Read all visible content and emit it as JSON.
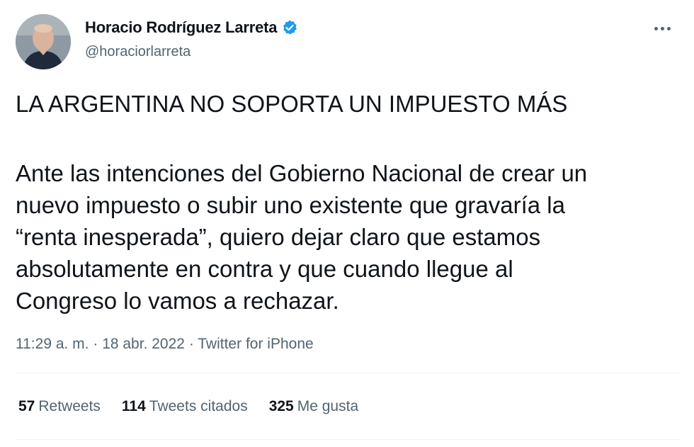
{
  "author": {
    "name": "Horacio Rodríguez Larreta",
    "handle": "@horaciorlarreta",
    "verified_icon": "verified-badge-icon"
  },
  "more_icon": "more-options-icon",
  "tweet": {
    "headline": "LA ARGENTINA NO SOPORTA UN IMPUESTO MÁS",
    "body_lines": [
      "Ante las intenciones del Gobierno Nacional de crear un",
      "nuevo impuesto o subir uno existente que gravaría la",
      "“renta inesperada”, quiero dejar claro que estamos",
      "absolutamente en contra y que cuando llegue al",
      "Congreso lo vamos a rechazar."
    ],
    "time": "11:29 a. m.",
    "separator": "·",
    "date": "18 abr. 2022",
    "source": "Twitter for iPhone"
  },
  "stats": [
    {
      "count": "57",
      "label": "Retweets"
    },
    {
      "count": "114",
      "label": "Tweets citados"
    },
    {
      "count": "325",
      "label": "Me gusta"
    }
  ],
  "colors": {
    "text": "#0f1419",
    "secondary": "#536471",
    "verified": "#1d9bf0",
    "divider": "#eff3f4"
  }
}
